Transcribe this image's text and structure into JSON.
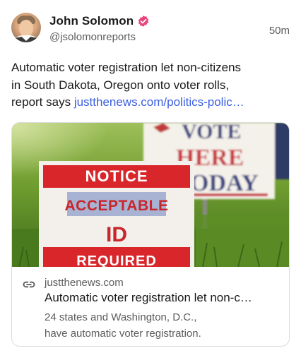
{
  "post": {
    "author": {
      "display_name": "John Solomon",
      "handle": "@jsolomonreports",
      "verified": true,
      "verified_color": "#e8457a"
    },
    "timestamp": "50m",
    "text_lines": [
      "Automatic voter registration let non-citizens",
      "in South Dakota, Oregon onto voter rolls,"
    ],
    "text_last_prefix": "report says ",
    "text_link": "justthenews.com/politics-polic…",
    "link_color": "#3c5fe0"
  },
  "card": {
    "image_signs": {
      "front_top": "NOTICE",
      "front_mid": "ACCEPTABLE",
      "front_id": "ID",
      "front_bottom": "REQUIRED",
      "back_line1": "VOTE",
      "back_line2": "HERE",
      "back_line3": "ODAY"
    },
    "domain": "justthenews.com",
    "title": "Automatic voter registration let non-c…",
    "description_lines": [
      "24 states and Washington, D.C.,",
      "have automatic voter registration."
    ],
    "icon": "link-icon"
  }
}
